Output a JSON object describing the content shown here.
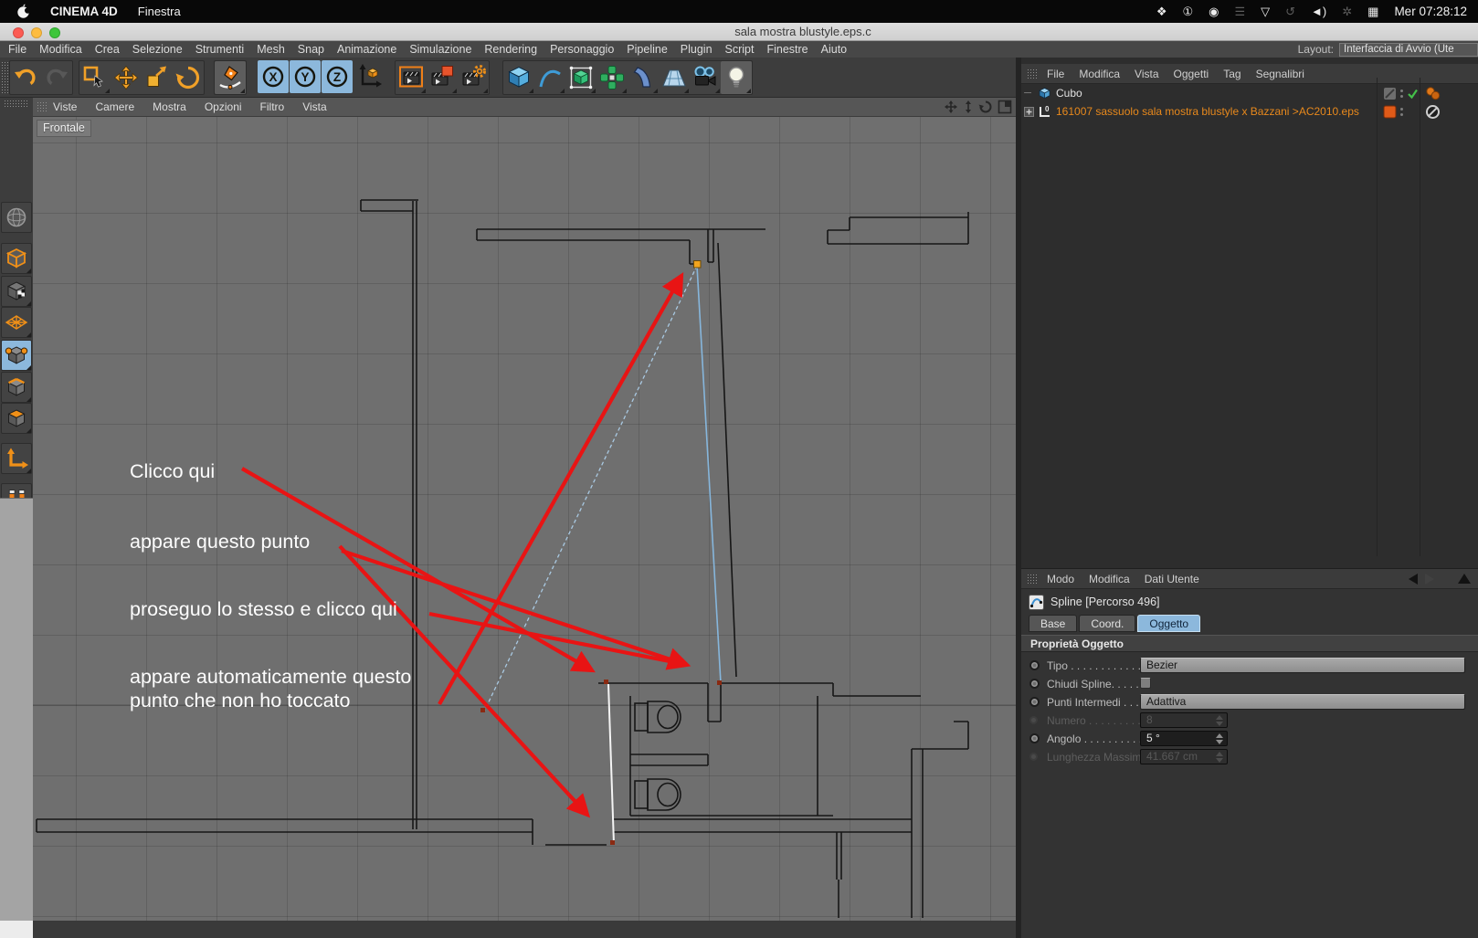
{
  "menu_bar": {
    "app_name": "CINEMA 4D",
    "window_menu": "Finestra",
    "clock": "Mer 07:28:12",
    "status_icons": [
      {
        "name": "dropbox-icon",
        "glyph": "❖",
        "dim": false
      },
      {
        "name": "onepassword-icon",
        "glyph": "①",
        "dim": false
      },
      {
        "name": "creative-cloud-icon",
        "glyph": "◉",
        "dim": false
      },
      {
        "name": "columns-icon",
        "glyph": "☰",
        "dim": true
      },
      {
        "name": "wifi-icon",
        "glyph": "▽",
        "dim": false
      },
      {
        "name": "time-machine-icon",
        "glyph": "↺",
        "dim": true
      },
      {
        "name": "volume-icon",
        "glyph": "◄)",
        "dim": false
      },
      {
        "name": "bluetooth-icon",
        "glyph": "✲",
        "dim": true
      },
      {
        "name": "keyboard-icon",
        "glyph": "▦",
        "dim": false
      }
    ]
  },
  "window": {
    "title": "sala mostra blustyle.eps.c"
  },
  "app_menu": {
    "items": [
      "File",
      "Modifica",
      "Crea",
      "Selezione",
      "Strumenti",
      "Mesh",
      "Snap",
      "Animazione",
      "Simulazione",
      "Rendering",
      "Personaggio",
      "Pipeline",
      "Plugin",
      "Script",
      "Finestre",
      "Aiuto"
    ],
    "layout_label": "Layout:",
    "layout_value": "Interfaccia di Avvio (Ute"
  },
  "toolbar": {
    "axis_labels": [
      "X",
      "Y",
      "Z"
    ]
  },
  "viewport": {
    "menu": [
      "Viste",
      "Camere",
      "Mostra",
      "Opzioni",
      "Filtro",
      "Vista"
    ],
    "view_label": "Frontale",
    "annotations": [
      {
        "text": "Clicco qui"
      },
      {
        "text": "appare questo punto"
      },
      {
        "text": "proseguo lo stesso e clicco qui"
      },
      {
        "text": "appare automaticamente questo\npunto che non ho toccato"
      }
    ]
  },
  "object_manager": {
    "menu": [
      "File",
      "Modifica",
      "Vista",
      "Oggetti",
      "Tag",
      "Segnalibri"
    ],
    "items": [
      {
        "name": "Cubo"
      },
      {
        "name": "161007 sassuolo sala mostra blustyle x Bazzani >AC2010.eps"
      }
    ]
  },
  "attribute_manager": {
    "menu": [
      "Modo",
      "Modifica",
      "Dati Utente"
    ],
    "object_title": "Spline [Percorso 496]",
    "tabs": [
      "Base",
      "Coord.",
      "Oggetto"
    ],
    "active_tab": "Oggetto",
    "section_title": "Proprietà Oggetto",
    "properties": [
      {
        "label": "Tipo . . . . . . . . . . . . . .",
        "value": "Bezier",
        "control": "dropdown",
        "enabled": true
      },
      {
        "label": "Chiudi Spline. . . . . . .",
        "value": "",
        "control": "checkbox",
        "enabled": true
      },
      {
        "label": "Punti Intermedi . . . . .",
        "value": "Adattiva",
        "control": "dropdown",
        "enabled": true
      },
      {
        "label": "Numero . . . . . . . . . .",
        "value": "8",
        "control": "number",
        "enabled": false
      },
      {
        "label": "Angolo . . . . . . . . . . .",
        "value": "5 °",
        "control": "number",
        "enabled": true
      },
      {
        "label": "Lunghezza Massima",
        "value": "41.667 cm",
        "control": "number",
        "enabled": false
      }
    ]
  },
  "colors": {
    "accent_orange": "#f0a028",
    "selection_blue": "#8cb8dc",
    "annotation_red": "#e81414",
    "spline_blue": "#86b6dc",
    "object_orange_text": "#e8891c",
    "selected_point": "#f2a51f"
  }
}
